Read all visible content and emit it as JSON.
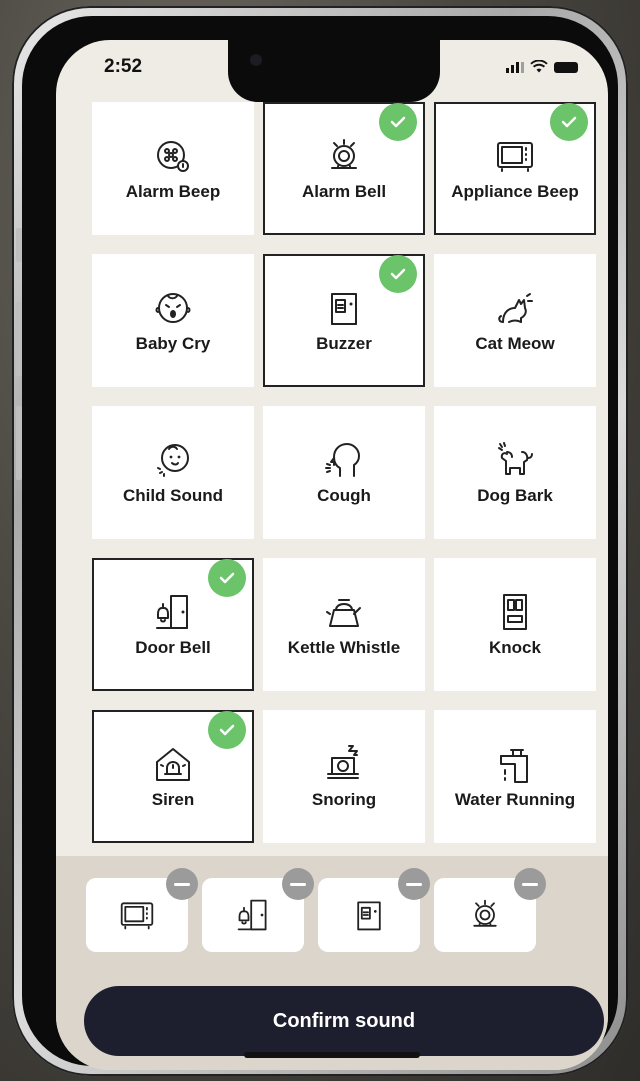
{
  "status_bar": {
    "time": "2:52",
    "icons": [
      "signal-icon",
      "wifi-icon",
      "battery-icon"
    ]
  },
  "colors": {
    "check": "#6bc36a",
    "tile_bg": "#ffffff",
    "screen_bg": "#efece6",
    "tray_bg": "#dcd5cc",
    "confirm_bg": "#1d1f2e"
  },
  "sounds": [
    {
      "label": "Alarm Beep",
      "icon": "alarm-beep-icon",
      "selected": false
    },
    {
      "label": "Alarm Bell",
      "icon": "alarm-bell-icon",
      "selected": true
    },
    {
      "label": "Appliance Beep",
      "icon": "microwave-icon",
      "selected": true
    },
    {
      "label": "Baby Cry",
      "icon": "baby-cry-icon",
      "selected": false
    },
    {
      "label": "Buzzer",
      "icon": "buzzer-icon",
      "selected": true
    },
    {
      "label": "Cat Meow",
      "icon": "cat-icon",
      "selected": false
    },
    {
      "label": "Child Sound",
      "icon": "child-icon",
      "selected": false
    },
    {
      "label": "Cough",
      "icon": "cough-icon",
      "selected": false
    },
    {
      "label": "Dog Bark",
      "icon": "dog-icon",
      "selected": false
    },
    {
      "label": "Door Bell",
      "icon": "door-bell-icon",
      "selected": true
    },
    {
      "label": "Kettle Whistle",
      "icon": "kettle-icon",
      "selected": false
    },
    {
      "label": "Knock",
      "icon": "knock-door-icon",
      "selected": false
    },
    {
      "label": "Siren",
      "icon": "siren-icon",
      "selected": true
    },
    {
      "label": "Snoring",
      "icon": "snoring-icon",
      "selected": false
    },
    {
      "label": "Water Running",
      "icon": "faucet-icon",
      "selected": false
    }
  ],
  "selected_tray": [
    {
      "icon": "microwave-icon"
    },
    {
      "icon": "door-bell-icon"
    },
    {
      "icon": "buzzer-icon"
    },
    {
      "icon": "alarm-bell-icon"
    }
  ],
  "confirm_label": "Confirm sound"
}
